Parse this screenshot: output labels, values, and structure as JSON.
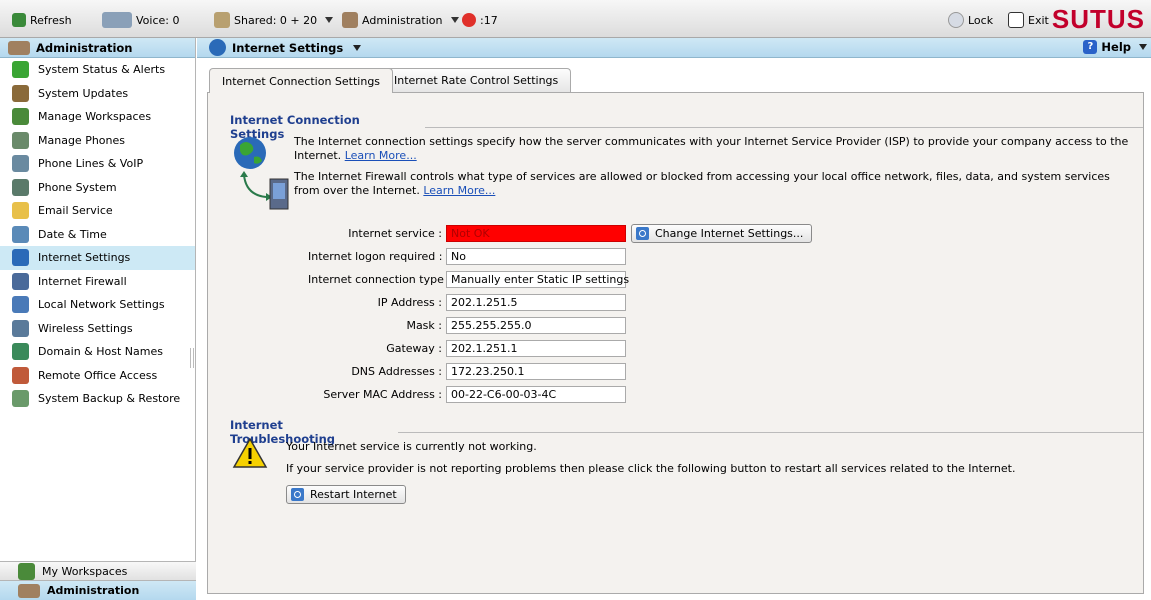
{
  "toolbar": {
    "refresh": "Refresh",
    "voice": "Voice: 0",
    "shared": "Shared: 0 + 20",
    "administration": "Administration",
    "alert_count": ":17",
    "lock": "Lock",
    "exit": "Exit",
    "brand": "SUTUS"
  },
  "sidebar": {
    "header": "Administration",
    "items": [
      {
        "label": "System Status & Alerts",
        "icon": "check-icon",
        "color": "#3aa534"
      },
      {
        "label": "System Updates",
        "icon": "tools-icon",
        "color": "#8a6a3a"
      },
      {
        "label": "Manage Workspaces",
        "icon": "workspaces-icon",
        "color": "#4a8a3a"
      },
      {
        "label": "Manage Phones",
        "icon": "phones-icon",
        "color": "#6a8a6a"
      },
      {
        "label": "Phone Lines & VoIP",
        "icon": "phone-lines-icon",
        "color": "#6a8aa0"
      },
      {
        "label": "Phone System",
        "icon": "phone-system-icon",
        "color": "#5a7a6a"
      },
      {
        "label": "Email Service",
        "icon": "envelope-icon",
        "color": "#e8c04a"
      },
      {
        "label": "Date & Time",
        "icon": "clock-icon",
        "color": "#5a8ab8"
      },
      {
        "label": "Internet Settings",
        "icon": "globe-icon",
        "color": "#2a6ab8"
      },
      {
        "label": "Internet Firewall",
        "icon": "firewall-icon",
        "color": "#4a6a9a"
      },
      {
        "label": "Local Network Settings",
        "icon": "network-icon",
        "color": "#4a7ab8"
      },
      {
        "label": "Wireless Settings",
        "icon": "wireless-icon",
        "color": "#5a7a9a"
      },
      {
        "label": "Domain & Host Names",
        "icon": "domain-icon",
        "color": "#3a8a5a"
      },
      {
        "label": "Remote Office Access",
        "icon": "remote-office-icon",
        "color": "#c05a3a"
      },
      {
        "label": "System Backup & Restore",
        "icon": "backup-icon",
        "color": "#6a9a6a"
      }
    ],
    "active_index": 8,
    "bottom_workspaces": "My Workspaces",
    "bottom_admin": "Administration"
  },
  "main": {
    "title": "Internet Settings",
    "help": "Help",
    "tabs": [
      {
        "label": "Internet Connection Settings",
        "active": true
      },
      {
        "label": "Internet Rate Control Settings",
        "active": false
      }
    ],
    "connection": {
      "title": "Internet Connection Settings",
      "para1": "The Internet connection settings specify how the server communicates with your Internet Service Provider (ISP) to provide your company access to the Internet.",
      "para2": "The Internet Firewall controls what type of services are allowed or blocked from accessing your local office network, files, data, and system services from over the Internet.",
      "learn_more": "Learn More...",
      "fields": [
        {
          "label": "Internet service :",
          "value": "Not OK",
          "status": "error"
        },
        {
          "label": "Internet logon required :",
          "value": "No"
        },
        {
          "label": "Internet connection type :",
          "value": "Manually enter Static IP settings"
        },
        {
          "label": "IP Address :",
          "value": "202.1.251.5"
        },
        {
          "label": "Mask :",
          "value": "255.255.255.0"
        },
        {
          "label": "Gateway :",
          "value": "202.1.251.1"
        },
        {
          "label": "DNS Addresses :",
          "value": "172.23.250.1"
        },
        {
          "label": "Server MAC Address :",
          "value": "00-22-C6-00-03-4C"
        }
      ],
      "change_button": "Change Internet Settings..."
    },
    "troubleshooting": {
      "title": "Internet Troubleshooting",
      "line1": "Your Internet service is currently not working.",
      "line2": "If your service provider is not reporting problems then please click the following button to restart all services related to the Internet.",
      "restart_button": "Restart Internet"
    }
  },
  "colors": {
    "error": "#ff0000",
    "accent": "#1f3f8f",
    "brand": "#c2002b"
  }
}
